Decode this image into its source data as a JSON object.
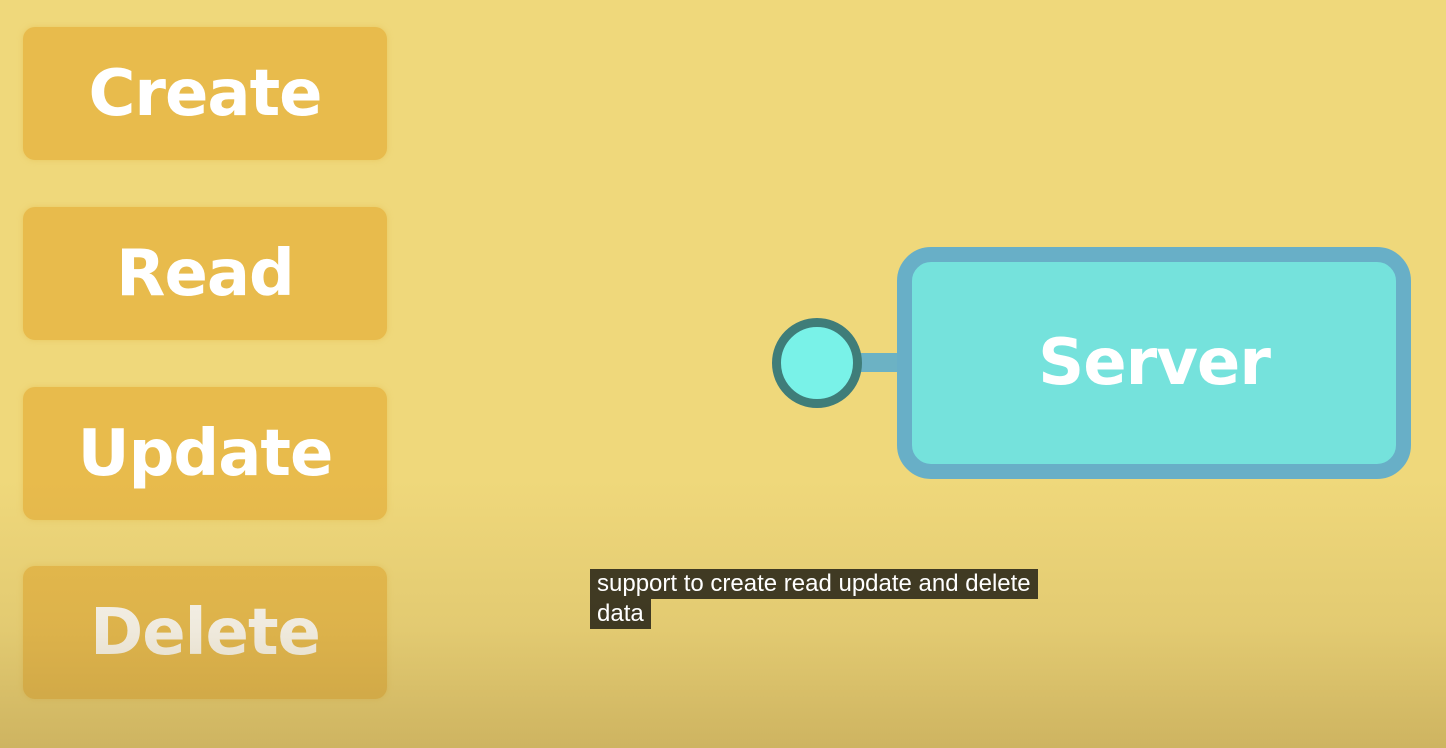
{
  "crud": {
    "create": "Create",
    "read": "Read",
    "update": "Update",
    "delete": "Delete"
  },
  "server": {
    "label": "Server"
  },
  "captions": {
    "line1": "support to create read update and delete",
    "line2": "data"
  },
  "colors": {
    "background": "#efd87b",
    "crud_box": "#e8bb4c",
    "server_fill": "#75e2dc",
    "server_border": "#68afc7",
    "node_fill": "#79f2e8",
    "node_border": "#3f7d79",
    "caption_bg": "#080808"
  }
}
